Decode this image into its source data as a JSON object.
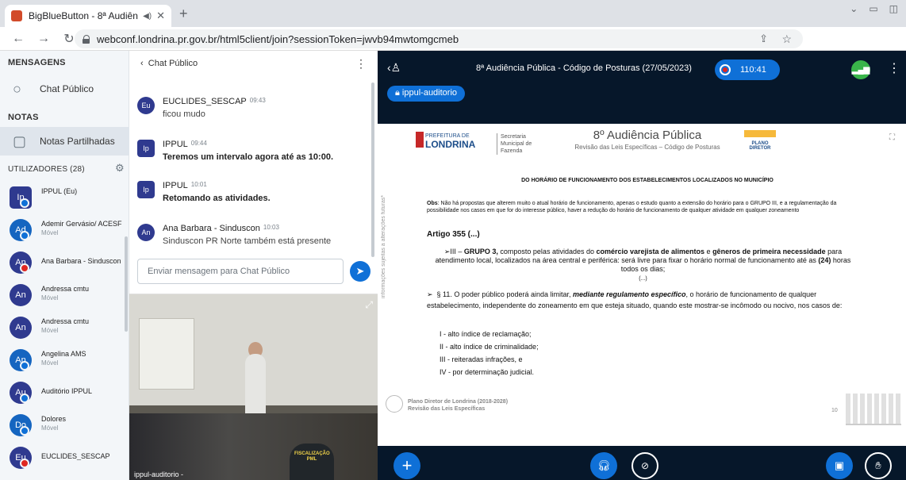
{
  "browser": {
    "tab_title": "BigBlueButton - 8ª Audiênci",
    "url": "webconf.londrina.pr.gov.br/html5client/join?sessionToken=jwvb94mwtomgcmeb",
    "profile_initial": "9"
  },
  "sidebar": {
    "messages_heading": "MENSAGENS",
    "public_chat_label": "Chat Público",
    "notes_heading": "NOTAS",
    "shared_notes_label": "Notas Partilhadas",
    "users_heading": "UTILIZADORES (28)",
    "users": [
      {
        "initials": "Ip",
        "name": "IPPUL (Eu)",
        "sub": "",
        "mic": "on"
      },
      {
        "initials": "Ad",
        "name": "Ademir Gervásio/ ACESF",
        "sub": "Móvel",
        "mic": "on"
      },
      {
        "initials": "An",
        "name": "Ana Barbara - Sinduscon",
        "sub": "",
        "mic": "muted"
      },
      {
        "initials": "An",
        "name": "Andressa cmtu",
        "sub": "Móvel",
        "mic": "none"
      },
      {
        "initials": "An",
        "name": "Andressa cmtu",
        "sub": "Móvel",
        "mic": "none"
      },
      {
        "initials": "An",
        "name": "Angelina AMS",
        "sub": "Móvel",
        "mic": "on"
      },
      {
        "initials": "Au",
        "name": "Auditório IPPUL",
        "sub": "",
        "mic": "on"
      },
      {
        "initials": "Do",
        "name": "Dolores",
        "sub": "Móvel",
        "mic": "on"
      },
      {
        "initials": "Eu",
        "name": "EUCLIDES_SESCAP",
        "sub": "",
        "mic": "muted"
      }
    ]
  },
  "chat": {
    "header": "Chat Público",
    "messages": [
      {
        "initials": "Eu",
        "author": "EUCLIDES_SESCAP",
        "time": "09:43",
        "text": "ficou mudo",
        "bold": false
      },
      {
        "initials": "Ip",
        "author": "IPPUL",
        "time": "09:44",
        "text": "Teremos um intervalo agora até as 10:00.",
        "bold": true
      },
      {
        "initials": "Ip",
        "author": "IPPUL",
        "time": "10:01",
        "text": "Retomando as atividades.",
        "bold": true
      },
      {
        "initials": "An",
        "author": "Ana Barbara - Sinduscon",
        "time": "10:03",
        "text": "Sinduscon PR Norte também está presente",
        "bold": false
      }
    ],
    "input_placeholder": "Enviar mensagem para Chat Público"
  },
  "webcam": {
    "label": "ippul-auditorio -",
    "vest_text": "FISCALIZAÇÃO PML"
  },
  "meeting": {
    "title": "8ª Audiência Pública - Código de Posturas (27/05/2023)",
    "timer": "110:41",
    "presenter_pill": "ippul-auditorio"
  },
  "slide": {
    "logo_line1": "PREFEITURA DE",
    "logo_line2": "LONDRINA",
    "secretaria": "Secretaria Municipal de Fazenda",
    "title": "8º Audiência Pública",
    "subtitle": "Revisão das Leis Específicas – Código de Posturas",
    "plano_logo": "PLANO DIRETOR",
    "side_text": "informações sujeitas a alterações futuras*",
    "heading": "DO HORÁRIO DE FUNCIONAMENTO DOS ESTABELECIMENTOS LOCALIZADOS NO MUNICÍPIO",
    "obs_label": "Obs",
    "obs_text": ": Não há propostas que alterem muito o atual horário de funcionamento, apenas o estudo quanto a extensão do horário para o GRUPO III,   e  a regulamentação da possibilidade nos casos em que for do interesse público, haver a redução do horário de funcionamento de qualquer atividade em qualquer zoneamento",
    "article": "Artigo 355 (...)",
    "p1_a": "III – ",
    "p1_b": "GRUPO 3,",
    "p1_c": " composto pelas atividades do ",
    "p1_d": "comércio varejista de alimentos",
    "p1_e": " e ",
    "p1_f": "gêneros de primeira necessidade",
    "p1_g": " para atendimento local, localizados na área central e periférica: será livre para fixar o horário normal de funcionamento até as ",
    "p1_h": "(24)",
    "p1_i": " horas todos os dias;",
    "p1_ellipsis": "(...)",
    "p2_a": "§ 11. O poder público poderá ainda limitar, ",
    "p2_b": "mediante regulamento específico",
    "p2_c": ", o horário de funcionamento de qualquer estabelecimento, independente do zoneamento em que esteja situado, quando este mostrar-se incômodo ou nocivo, nos casos de:",
    "items": [
      "I - alto índice de reclamação;",
      "II - alto índice de criminalidade;",
      "III - reiteradas infrações, e",
      "IV - por determinação judicial."
    ],
    "footer_line1": "Plano Diretor de Londrina (2018-2028)",
    "footer_line2": "Revisão das Leis Específicas",
    "page_number": "10"
  }
}
